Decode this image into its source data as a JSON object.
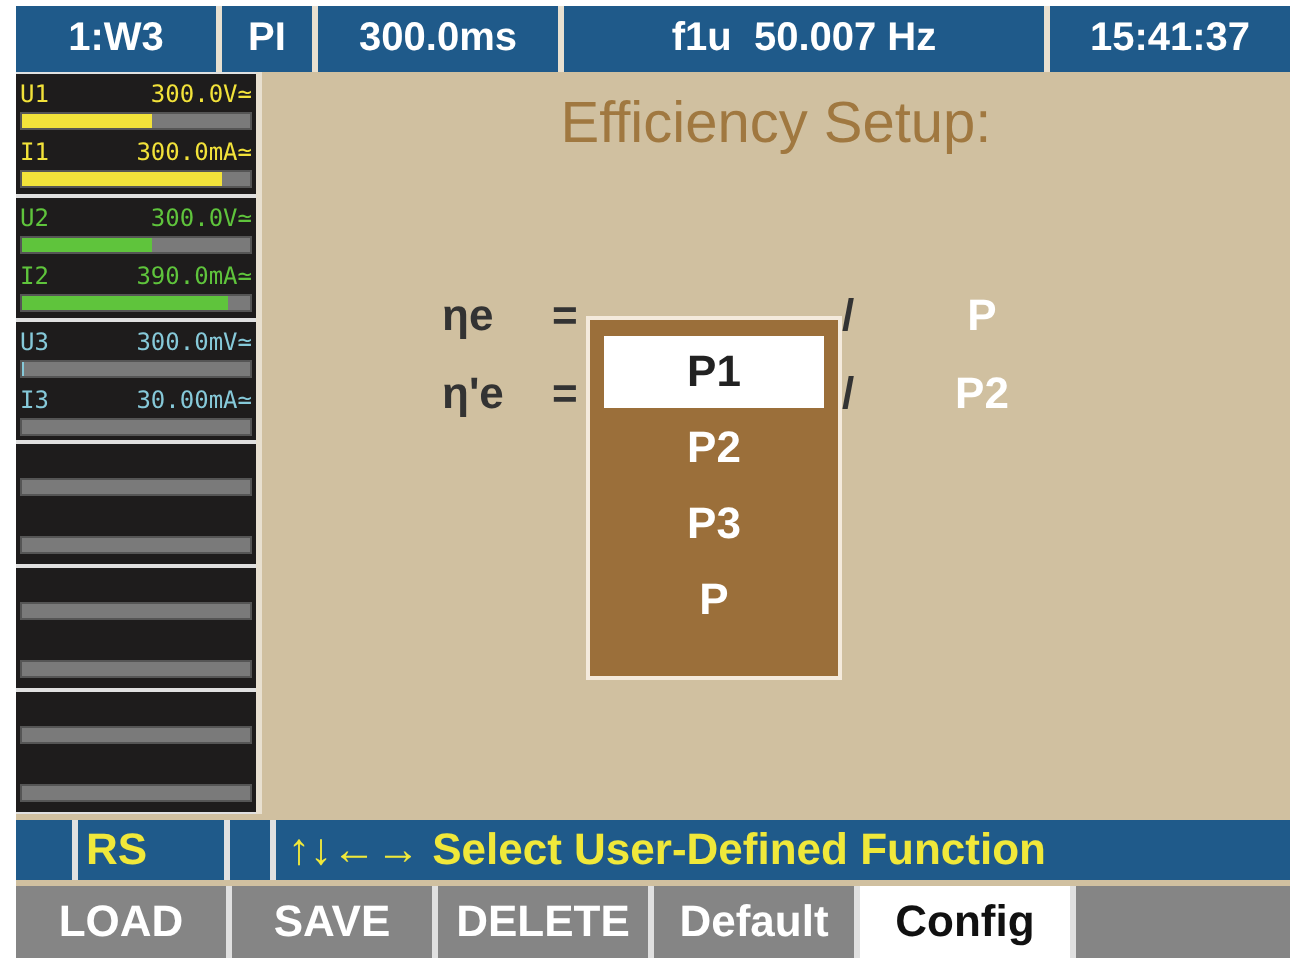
{
  "header": {
    "cells": [
      "1:W3",
      "PI",
      "300.0ms",
      "f1u  50.007 Hz",
      "15:41:37"
    ]
  },
  "channels": [
    {
      "kind": "meter",
      "color": "#f2e23a",
      "rows": [
        {
          "name": "U1",
          "value": "300.0V≃",
          "level": 0.57
        },
        {
          "name": "I1",
          "value": "300.0mA≃",
          "level": 0.88
        }
      ]
    },
    {
      "kind": "meter",
      "color": "#5fc43c",
      "rows": [
        {
          "name": "U2",
          "value": "300.0V≃",
          "level": 0.57
        },
        {
          "name": "I2",
          "value": "390.0mA≃",
          "level": 0.9
        }
      ]
    },
    {
      "kind": "meter",
      "color": "#86c9d9",
      "rows": [
        {
          "name": "U3",
          "value": "300.0mV≃",
          "level": 0.01
        },
        {
          "name": "I3",
          "value": "30.00mA≃"
        }
      ]
    },
    {
      "kind": "empty"
    },
    {
      "kind": "empty"
    },
    {
      "kind": "empty"
    }
  ],
  "title": "Efficiency Setup:",
  "formulas": [
    {
      "symbol": "ηe",
      "equals": "=",
      "slash": "/",
      "denominator": "P"
    },
    {
      "symbol": "η'e",
      "equals": "=",
      "slash": "/",
      "denominator": "P2"
    }
  ],
  "dropdown": {
    "options": [
      {
        "label": "P1",
        "selected": true
      },
      {
        "label": "P2",
        "selected": false
      },
      {
        "label": "P3",
        "selected": false
      },
      {
        "label": "P",
        "selected": false
      }
    ]
  },
  "status": {
    "mode": "RS",
    "message": "↑↓←→ Select User-Defined Function"
  },
  "softkeys": [
    {
      "label": "LOAD",
      "selected": false
    },
    {
      "label": "SAVE",
      "selected": false
    },
    {
      "label": "DELETE",
      "selected": false
    },
    {
      "label": "Default",
      "selected": false
    },
    {
      "label": "Config",
      "selected": true
    }
  ]
}
